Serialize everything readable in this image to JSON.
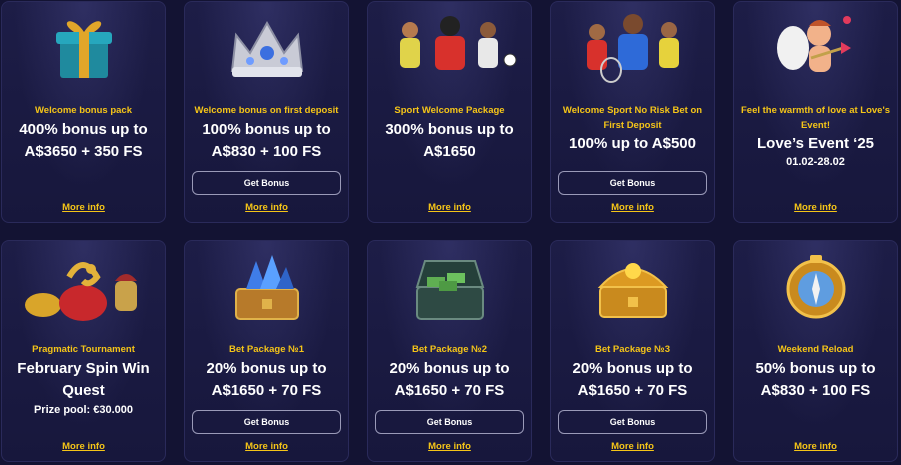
{
  "promotions": [
    {
      "subtitle": "Welcome bonus pack",
      "headline": "400% bonus up to A$3650 + 350 FS",
      "extra": "",
      "button_label": "",
      "link_label": "More info",
      "icon": "gift-box-icon"
    },
    {
      "subtitle": "Welcome bonus on first deposit",
      "headline": "100% bonus up to A$830 + 100 FS",
      "extra": "",
      "button_label": "Get Bonus",
      "link_label": "More info",
      "icon": "crown-icon"
    },
    {
      "subtitle": "Sport Welcome Package",
      "headline": "300% bonus up to A$1650",
      "extra": "",
      "button_label": "",
      "link_label": "More info",
      "icon": "sports-players-icon"
    },
    {
      "subtitle": "Welcome Sport No Risk Bet on First Deposit",
      "headline": "100% up to A$500",
      "extra": "",
      "button_label": "Get Bonus",
      "link_label": "More info",
      "icon": "sports-team-icon"
    },
    {
      "subtitle": "Feel the warmth of love at Love's Event!",
      "headline": "Love’s Event ‘25",
      "extra": "01.02-28.02",
      "button_label": "",
      "link_label": "More info",
      "icon": "cupid-icon"
    },
    {
      "subtitle": "Pragmatic Tournament",
      "headline": "February Spin Win Quest",
      "extra": "Prize pool: €30.000",
      "button_label": "",
      "link_label": "More info",
      "icon": "treasure-snake-icon"
    },
    {
      "subtitle": "Bet Package №1",
      "headline": "20% bonus up to A$1650 + 70 FS",
      "extra": "",
      "button_label": "Get Bonus",
      "link_label": "More info",
      "icon": "crystal-chest-icon"
    },
    {
      "subtitle": "Bet Package №2",
      "headline": "20% bonus up to A$1650 + 70 FS",
      "extra": "",
      "button_label": "Get Bonus",
      "link_label": "More info",
      "icon": "money-chest-icon"
    },
    {
      "subtitle": "Bet Package №3",
      "headline": "20% bonus up to A$1650 + 70 FS",
      "extra": "",
      "button_label": "Get Bonus",
      "link_label": "More info",
      "icon": "gold-chest-icon"
    },
    {
      "subtitle": "Weekend Reload",
      "headline": "50% bonus up to A$830 + 100 FS",
      "extra": "",
      "button_label": "",
      "link_label": "More info",
      "icon": "compass-icon"
    }
  ],
  "colors": {
    "background": "#131333",
    "card": "#1d1d47",
    "accent": "#f5c518",
    "text": "#ffffff"
  }
}
